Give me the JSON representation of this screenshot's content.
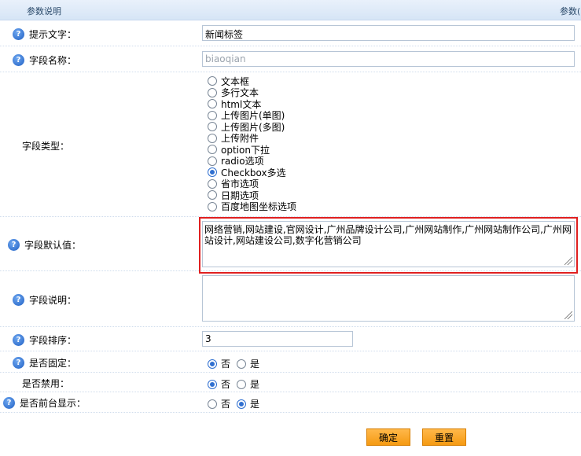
{
  "header": {
    "left": "参数说明",
    "right": "参数("
  },
  "fields": {
    "hint_label": "提示文字：",
    "hint_value": "新闻标签",
    "name_label": "字段名称：",
    "name_placeholder": "biaoqian",
    "type_label": "字段类型：",
    "type_options": [
      "文本框",
      "多行文本",
      "html文本",
      "上传图片(单图)",
      "上传图片(多图)",
      "上传附件",
      "option下拉",
      "radio选项",
      "Checkbox多选",
      "省市选项",
      "日期选项",
      "百度地图坐标选项"
    ],
    "type_selected": "Checkbox多选",
    "default_label": "字段默认值：",
    "default_value": "网络营销,网站建设,官网设计,广州品牌设计公司,广州网站制作,广州网站制作公司,广州网站设计,网站建设公司,数字化营销公司",
    "desc_label": "字段说明：",
    "desc_value": "",
    "order_label": "字段排序：",
    "order_value": "3",
    "fixed_label": "是否固定：",
    "disabled_label": "是否禁用：",
    "frontend_label": "是否前台显示：",
    "no": "否",
    "yes": "是"
  },
  "buttons": {
    "confirm": "确定",
    "reset": "重置"
  }
}
